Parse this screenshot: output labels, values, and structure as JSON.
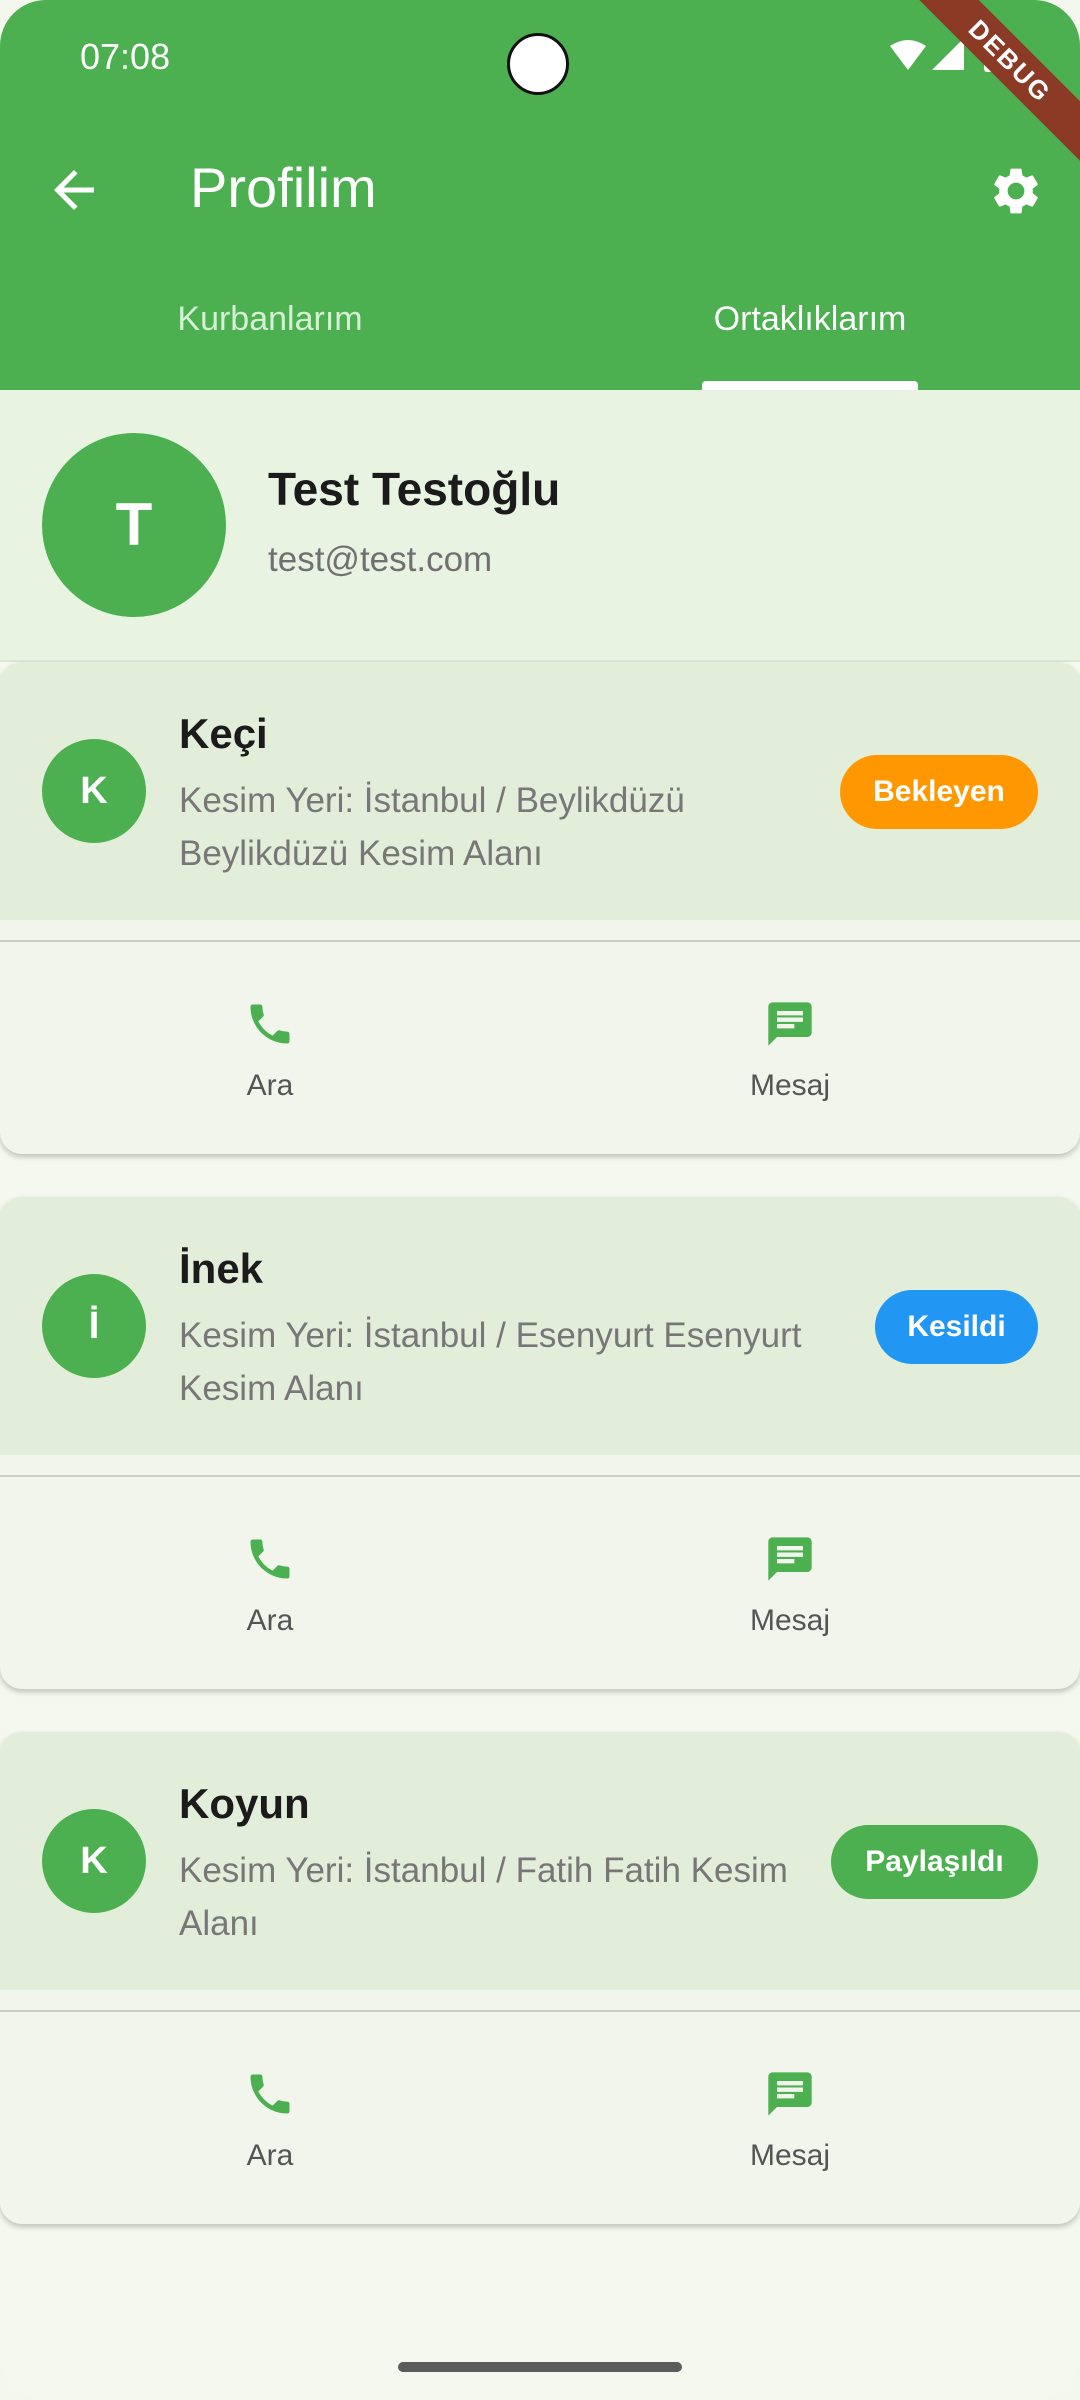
{
  "status": {
    "time": "07:08",
    "debug_label": "DEBUG"
  },
  "appbar": {
    "title": "Profilim"
  },
  "tabs": [
    {
      "label": "Kurbanlarım",
      "active": false
    },
    {
      "label": "Ortaklıklarım",
      "active": true
    }
  ],
  "profile": {
    "initial": "T",
    "name": "Test Testoğlu",
    "email": "test@test.com"
  },
  "cards": [
    {
      "initial": "K",
      "animal": "Keçi",
      "location": "Kesim Yeri: İstanbul / Beylikdüzü Beylikdüzü Kesim Alanı",
      "status": "Bekleyen",
      "status_color": "#ff9800",
      "call_label": "Ara",
      "message_label": "Mesaj"
    },
    {
      "initial": "İ",
      "animal": "İnek",
      "location": "Kesim Yeri: İstanbul / Esenyurt Esenyurt Kesim Alanı",
      "status": "Kesildi",
      "status_color": "#2196f3",
      "call_label": "Ara",
      "message_label": "Mesaj"
    },
    {
      "initial": "K",
      "animal": "Koyun",
      "location": "Kesim Yeri: İstanbul / Fatih Fatih Kesim Alanı",
      "status": "Paylaşıldı",
      "status_color": "#4caf50",
      "call_label": "Ara",
      "message_label": "Mesaj"
    }
  ],
  "colors": {
    "primary": "#4caf50",
    "pending": "#ff9800",
    "slaughtered": "#2196f3",
    "shared": "#4caf50"
  },
  "icons": {
    "back": "arrow-back-icon",
    "settings": "gear-icon",
    "call": "phone-icon",
    "message": "message-icon"
  }
}
